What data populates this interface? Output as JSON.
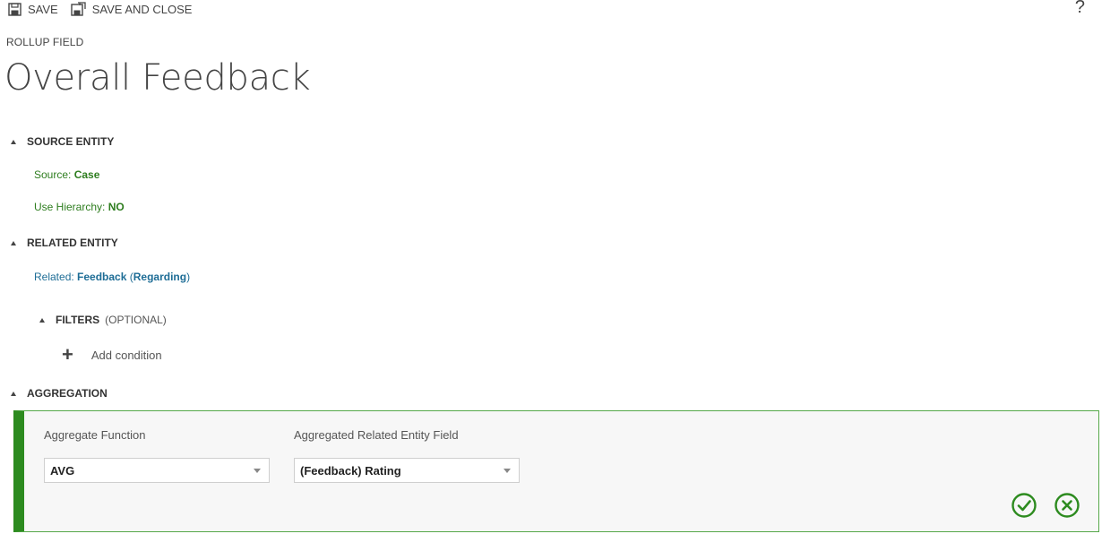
{
  "toolbar": {
    "save_label": "SAVE",
    "save_close_label": "SAVE AND CLOSE",
    "help_label": "?"
  },
  "header": {
    "entity_type": "ROLLUP FIELD",
    "title": "Overall Feedback"
  },
  "source_entity": {
    "heading": "SOURCE ENTITY",
    "source_label": "Source:",
    "source_value": "Case",
    "hierarchy_label": "Use Hierarchy:",
    "hierarchy_value": "NO"
  },
  "related_entity": {
    "heading": "RELATED ENTITY",
    "related_label": "Related:",
    "related_value": "Feedback",
    "open_paren": "(",
    "relationship": "Regarding",
    "close_paren": ")",
    "filters": {
      "heading": "FILTERS",
      "optional_label": "(OPTIONAL)",
      "add_condition_label": "Add condition"
    }
  },
  "aggregation": {
    "heading": "AGGREGATION",
    "function_label": "Aggregate Function",
    "function_value": "AVG",
    "field_label": "Aggregated Related Entity Field",
    "field_value": "(Feedback) Rating",
    "accent_color": "#2d8b1f",
    "icons": [
      "confirm-check-icon",
      "cancel-x-icon"
    ]
  },
  "colors": {
    "green_text": "#2e7d1f",
    "blue_text": "#1e6d96"
  }
}
